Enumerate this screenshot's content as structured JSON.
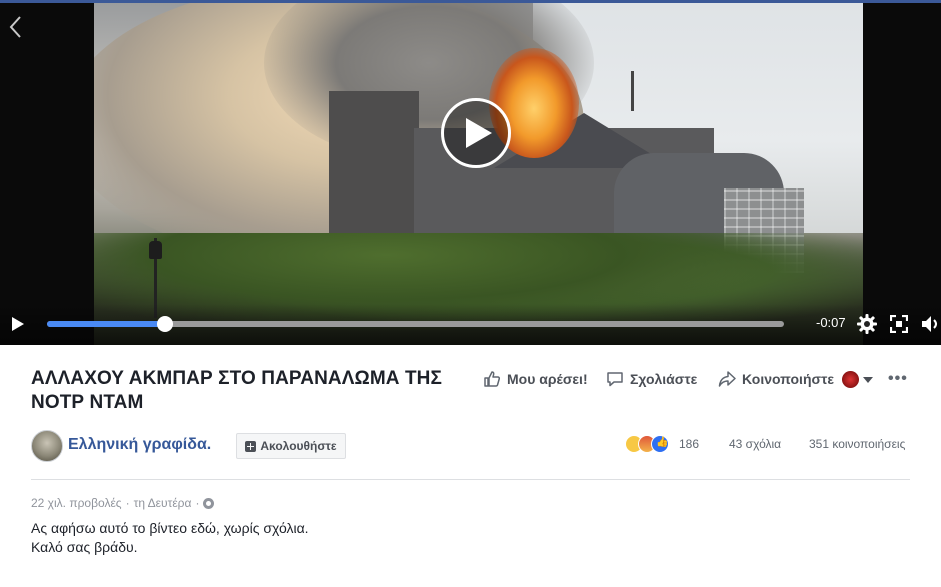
{
  "video": {
    "progress_fraction": 0.16,
    "time_remaining": "-0:07",
    "icons": {
      "back": "chevron-left-icon",
      "play_overlay": "play-icon",
      "play": "play-icon",
      "settings": "gear-icon",
      "fullscreen": "fullscreen-icon",
      "volume": "volume-icon"
    }
  },
  "post": {
    "title": "ΑΛΛΑΧΟΥ ΑΚΜΠΑΡ ΣΤΟ ΠΑΡΑΝΑΛΩΜΑ ΤΗΣ ΝΟΤΡ ΝΤΑΜ",
    "actions": {
      "like": "Μου αρέσει!",
      "comment": "Σχολιάστε",
      "share": "Κοινοποιήστε"
    },
    "page_name": "Ελληνική γραφίδα.",
    "follow_label": "Ακολουθήστε",
    "reactions_count": "186",
    "comments_count": "43 σχόλια",
    "shares_count": "351 κοινοποιήσεις",
    "meta": {
      "views": "22 χιλ. προβολές",
      "separator": " · ",
      "date": "τη Δευτέρα",
      "separator2": " · "
    },
    "description_line1": "Ας αφήσω αυτό το βίντεο εδώ, χωρίς σχόλια.",
    "description_line2": "Καλό σας βράδυ."
  },
  "colors": {
    "progress_fill": "#4a8af4",
    "link": "#365899",
    "top_bar": "#3b5998"
  }
}
